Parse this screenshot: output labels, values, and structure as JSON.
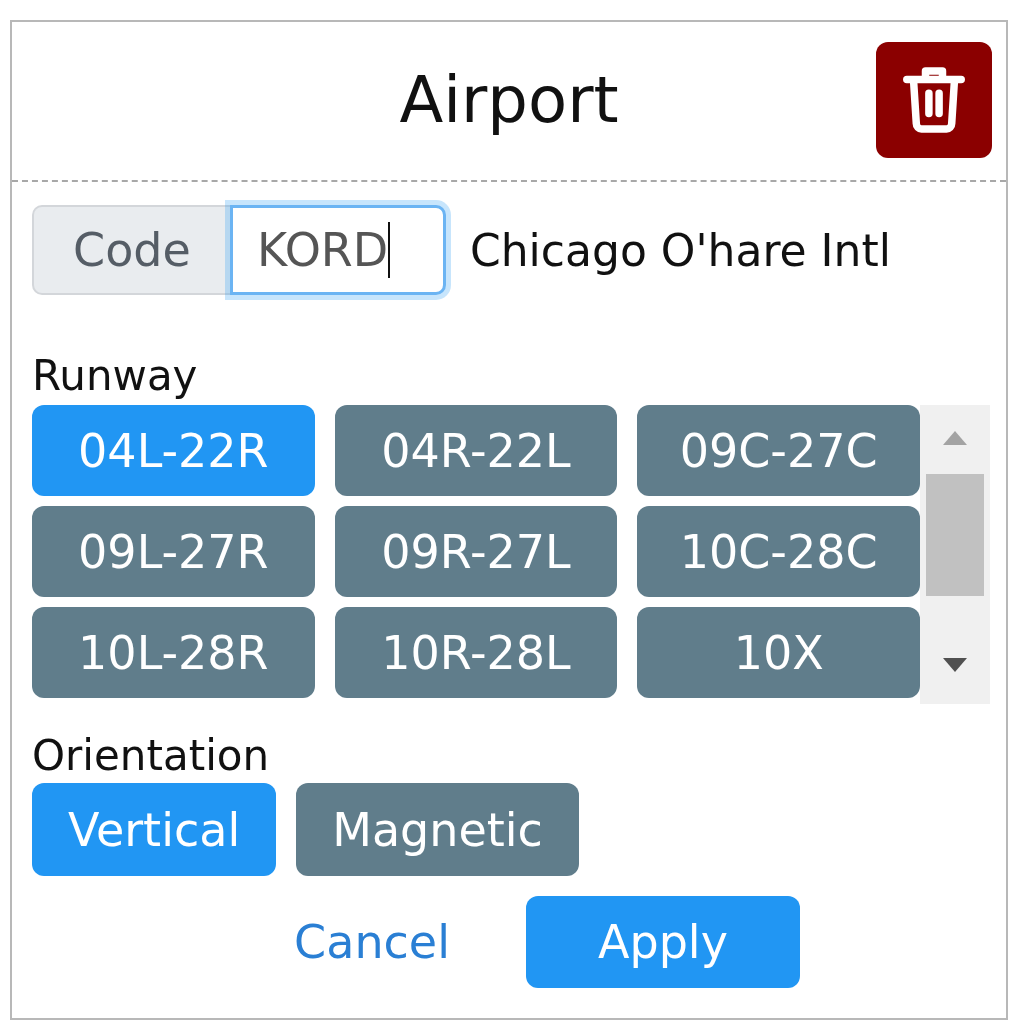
{
  "dialog": {
    "title": "Airport"
  },
  "code_field": {
    "label": "Code",
    "value": "KORD",
    "focused": true
  },
  "airport_name": "Chicago O'hare Intl",
  "runway": {
    "label": "Runway",
    "options": [
      {
        "label": "04L-22R",
        "selected": true
      },
      {
        "label": "04R-22L",
        "selected": false
      },
      {
        "label": "09C-27C",
        "selected": false
      },
      {
        "label": "09L-27R",
        "selected": false
      },
      {
        "label": "09R-27L",
        "selected": false
      },
      {
        "label": "10C-28C",
        "selected": false
      },
      {
        "label": "10L-28R",
        "selected": false
      },
      {
        "label": "10R-28L",
        "selected": false
      },
      {
        "label": "10X",
        "selected": false
      }
    ]
  },
  "orientation": {
    "label": "Orientation",
    "options": [
      {
        "label": "Vertical",
        "selected": true
      },
      {
        "label": "Magnetic",
        "selected": false
      }
    ]
  },
  "footer": {
    "cancel": "Cancel",
    "apply": "Apply"
  }
}
